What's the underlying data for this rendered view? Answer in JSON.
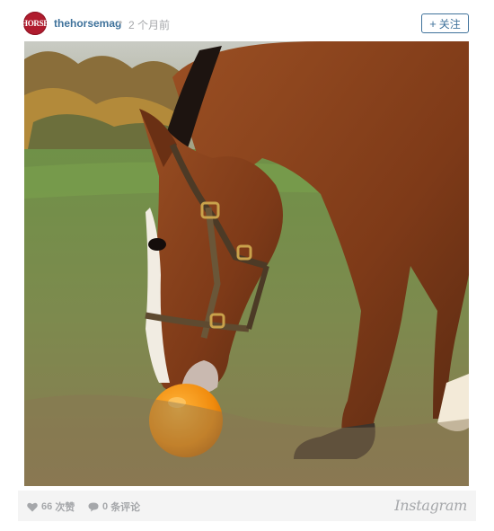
{
  "post": {
    "avatar_text": "HORSE",
    "username": "thehorsemag",
    "separator": "•",
    "timestamp": "2 个月前",
    "follow_label": "关注",
    "follow_plus": "+"
  },
  "photo": {
    "icon": "horse-photo"
  },
  "footer": {
    "likes_count": "66",
    "likes_label": "次赞",
    "comments_count": "0",
    "comments_label": "条评论",
    "brand": "Instagram"
  },
  "colors": {
    "link_blue": "#3f729b",
    "avatar_red": "#b01c2e",
    "muted_gray": "#a5a7aa",
    "footer_bg": "#f4f4f4"
  }
}
